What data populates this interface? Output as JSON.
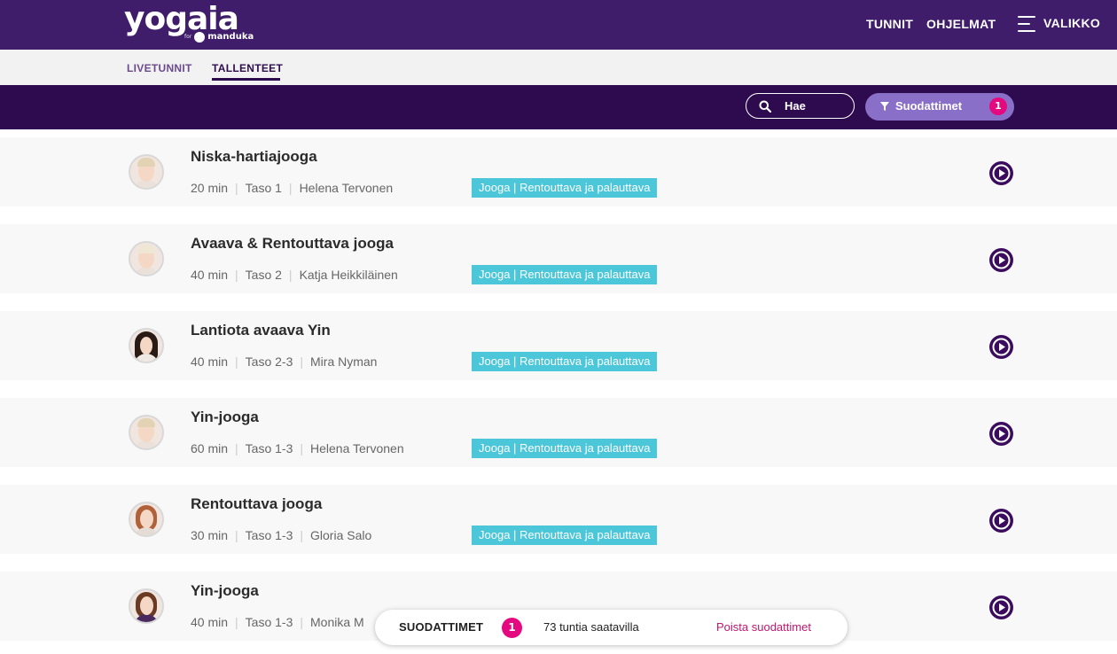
{
  "header": {
    "logo_text": "yogaia",
    "logo_sub_for": "for",
    "logo_sub_brand": "manduka",
    "nav": {
      "tunnit": "TUNNIT",
      "ohjelmat": "OHJELMAT",
      "menu": "VALIKKO"
    }
  },
  "tabs": {
    "live": "LIVETUNNIT",
    "recordings": "TALLENTEET",
    "active": "TALLENTEET"
  },
  "toolbar": {
    "search_label": "Hae",
    "filter_label": "Suodattimet",
    "filter_count": "1",
    "accent": "#8a6fc9",
    "badge_color": "#e5097f"
  },
  "classes": [
    {
      "title": "Niska-hartiajooga",
      "duration": "20 min",
      "level": "Taso 1",
      "instructor": "Helena Tervonen",
      "tag": "Jooga | Rentouttava ja palauttava"
    },
    {
      "title": "Avaava & Rentouttava jooga",
      "duration": "40 min",
      "level": "Taso 2",
      "instructor": "Katja Heikkiläinen",
      "tag": "Jooga | Rentouttava ja palauttava"
    },
    {
      "title": "Lantiota avaava Yin",
      "duration": "40 min",
      "level": "Taso 2-3",
      "instructor": "Mira Nyman",
      "tag": "Jooga | Rentouttava ja palauttava"
    },
    {
      "title": "Yin-jooga",
      "duration": "60 min",
      "level": "Taso 1-3",
      "instructor": "Helena Tervonen",
      "tag": "Jooga | Rentouttava ja palauttava"
    },
    {
      "title": "Rentouttava jooga",
      "duration": "30 min",
      "level": "Taso 1-3",
      "instructor": "Gloria Salo",
      "tag": "Jooga | Rentouttava ja palauttava"
    },
    {
      "title": "Yin-jooga",
      "duration": "40 min",
      "level": "Taso 1-3",
      "instructor": "Monika M",
      "tag": ""
    }
  ],
  "bottom_bar": {
    "label": "SUODATTIMET",
    "count": "1",
    "available": "73 tuntia saatavilla",
    "clear": "Poista suodattimet"
  }
}
